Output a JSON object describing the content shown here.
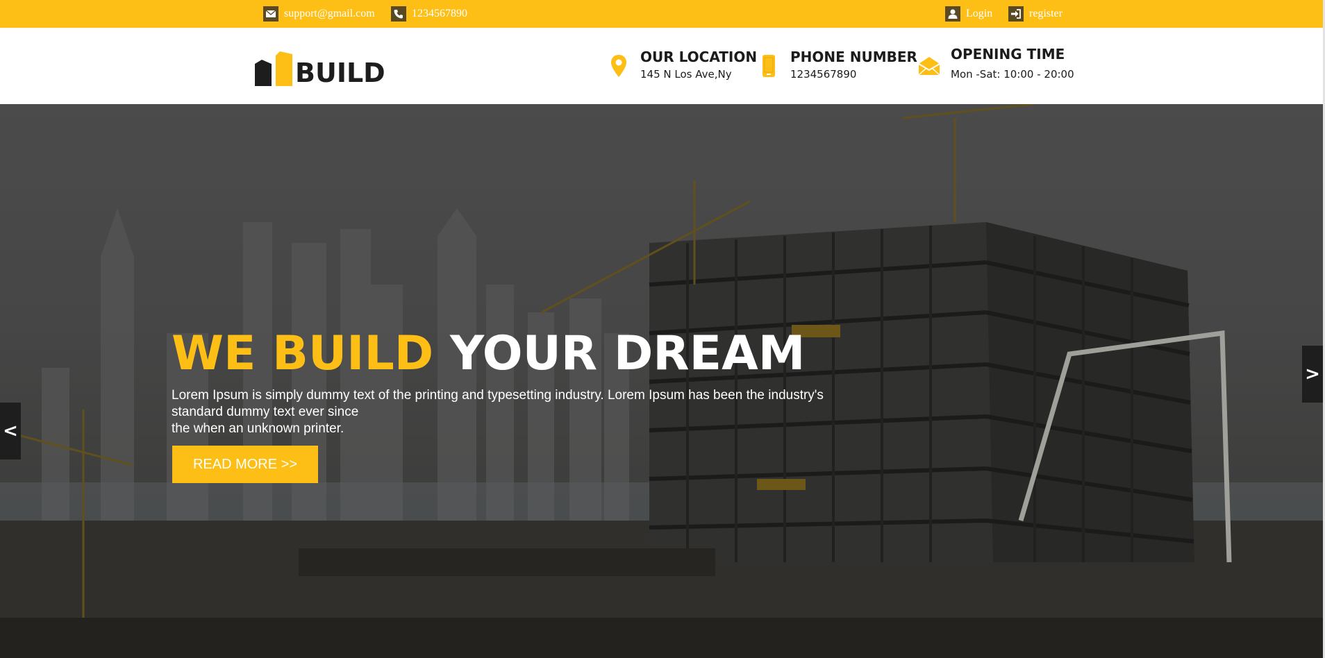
{
  "topbar": {
    "email": "support@gmail.com",
    "phone": "1234567890",
    "login": "Login",
    "register": "register",
    "icons": [
      "envelope-icon",
      "phone-icon",
      "user-icon",
      "sign-in-icon"
    ]
  },
  "header": {
    "logo_text": "BUILD",
    "location": {
      "title": "OUR LOCATION",
      "value": "145 N Los Ave,Ny",
      "icon": "map-pin-icon"
    },
    "phone": {
      "title": "PHONE NUMBER",
      "value": "1234567890",
      "icon": "mobile-icon"
    },
    "hours": {
      "title": "OPENING TIME",
      "value": "Mon -Sat: 10:00 - 20:00",
      "icon": "envelope-open-icon"
    }
  },
  "hero": {
    "headline_accent": "WE BUILD",
    "headline_rest": "YOUR DREAM",
    "description_line1": "Lorem Ipsum is simply dummy text of the printing and typesetting industry. Lorem Ipsum has been the industry's standard dummy text ever since",
    "description_line2": "the when an unknown printer.",
    "button_label": "READ MORE >>",
    "prev_label": "<",
    "next_label": ">"
  },
  "colors": {
    "accent": "#fdbe16",
    "dark": "#1d1d1d",
    "icon_box": "#5a4a24"
  }
}
